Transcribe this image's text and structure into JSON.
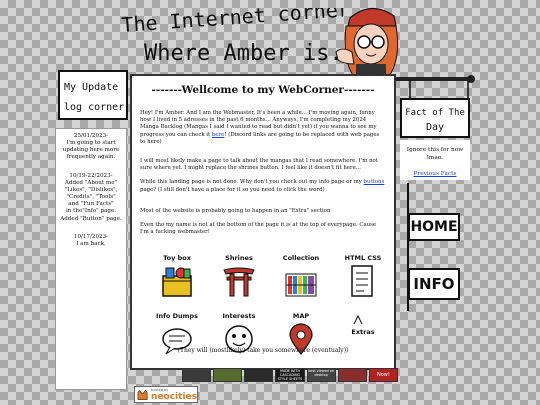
{
  "header": {
    "title_line1": "The Internet corner",
    "title_line2": "Where Amber is."
  },
  "updates": {
    "sign_line1": "My Update",
    "sign_line2": "log corner",
    "entries": [
      {
        "lines": [
          "25/01/2023-",
          "I'm going to start",
          "updating here more",
          "frequently again."
        ]
      },
      {
        "lines": [
          "10/19-22/2023-",
          "Added \"About me\"",
          "\"Likes\", \"Dislikes\",",
          "\"Credits\", \"Tools\"",
          "and \"Fun Facts\"",
          "in the\"Info\" page.",
          "Added \"Button\" page."
        ]
      },
      {
        "lines": [
          "10/17/2023-",
          "I am back,"
        ]
      }
    ]
  },
  "main": {
    "title": "-------Wellcome to my WebCorner-------",
    "p1_before": "Hey! I'm Amber. And I am the Webmaster, It's been a while... I'm moving again, funny how I lived in 5 adresses in the past 6 months... Anyways, I'm completing my 2024 Manga Backlog (Mangas I said I wanted to read but didn't yet) if you wanna to see my progress you can check it ",
    "p1_link": "here",
    "p1_after": "! (Discord links are going to be replaced with web pages to here)",
    "p2": "I will most likely make a page to talk about the mangas that I read somewhere. I'm not sure where yet. I might replace the shrines button. I feel like it doesn't fit here...",
    "p3_before": "While this landing page is not done. Why don't you check out my info page or my ",
    "p3_link": "buttons",
    "p3_after": " page? (I still don't have a place for it so you need to click the word)",
    "p4": "Most of the website is probably going to happen in an \"Extra\" section",
    "p5": "Even tho my name is not at the bottom of the page it is at the top of everypage. Cause I'm a fucking webmaster!",
    "icons": [
      {
        "label": "Toy box",
        "icon": "toy-box-icon"
      },
      {
        "label": "Shrines",
        "icon": "torii-icon"
      },
      {
        "label": "Collection",
        "icon": "collection-icon"
      },
      {
        "label": "HTML CSS",
        "icon": "html-css-icon"
      },
      {
        "label": "Info Dumps",
        "icon": "speech-bubble-icon"
      },
      {
        "label": "Interests",
        "icon": "face-icon"
      },
      {
        "label": "MAP",
        "icon": "map-pin-icon"
      },
      {
        "label": "Extras",
        "icon": "extras-icon"
      }
    ],
    "footer": "(They will (mostlikely) take you somewhere (eventualy))"
  },
  "fact": {
    "sign_line1": "Fact of The",
    "sign_line2": "Day",
    "text": "Ignore this for now lmao.",
    "link": "Previous Facts"
  },
  "nav": {
    "home": "HOME",
    "info": "INFO"
  },
  "badges": [
    {
      "text": "",
      "color": "#3a3a3a"
    },
    {
      "text": "",
      "color": "#556b2f"
    },
    {
      "text": "",
      "color": "#2b2b2b"
    },
    {
      "text": "MADE WITH CASCADING STYLE SHEETS",
      "color": "#1a1a1a"
    },
    {
      "text": "best viewed on desktop",
      "color": "#444"
    },
    {
      "text": "",
      "color": "#8a2d2d"
    },
    {
      "text": "Now!",
      "color": "#b22222"
    }
  ],
  "neocities": {
    "small": "hosted by",
    "label": "neocities"
  },
  "colors": {
    "accent_red": "#c0392b",
    "link_blue": "#1f3fcf"
  }
}
